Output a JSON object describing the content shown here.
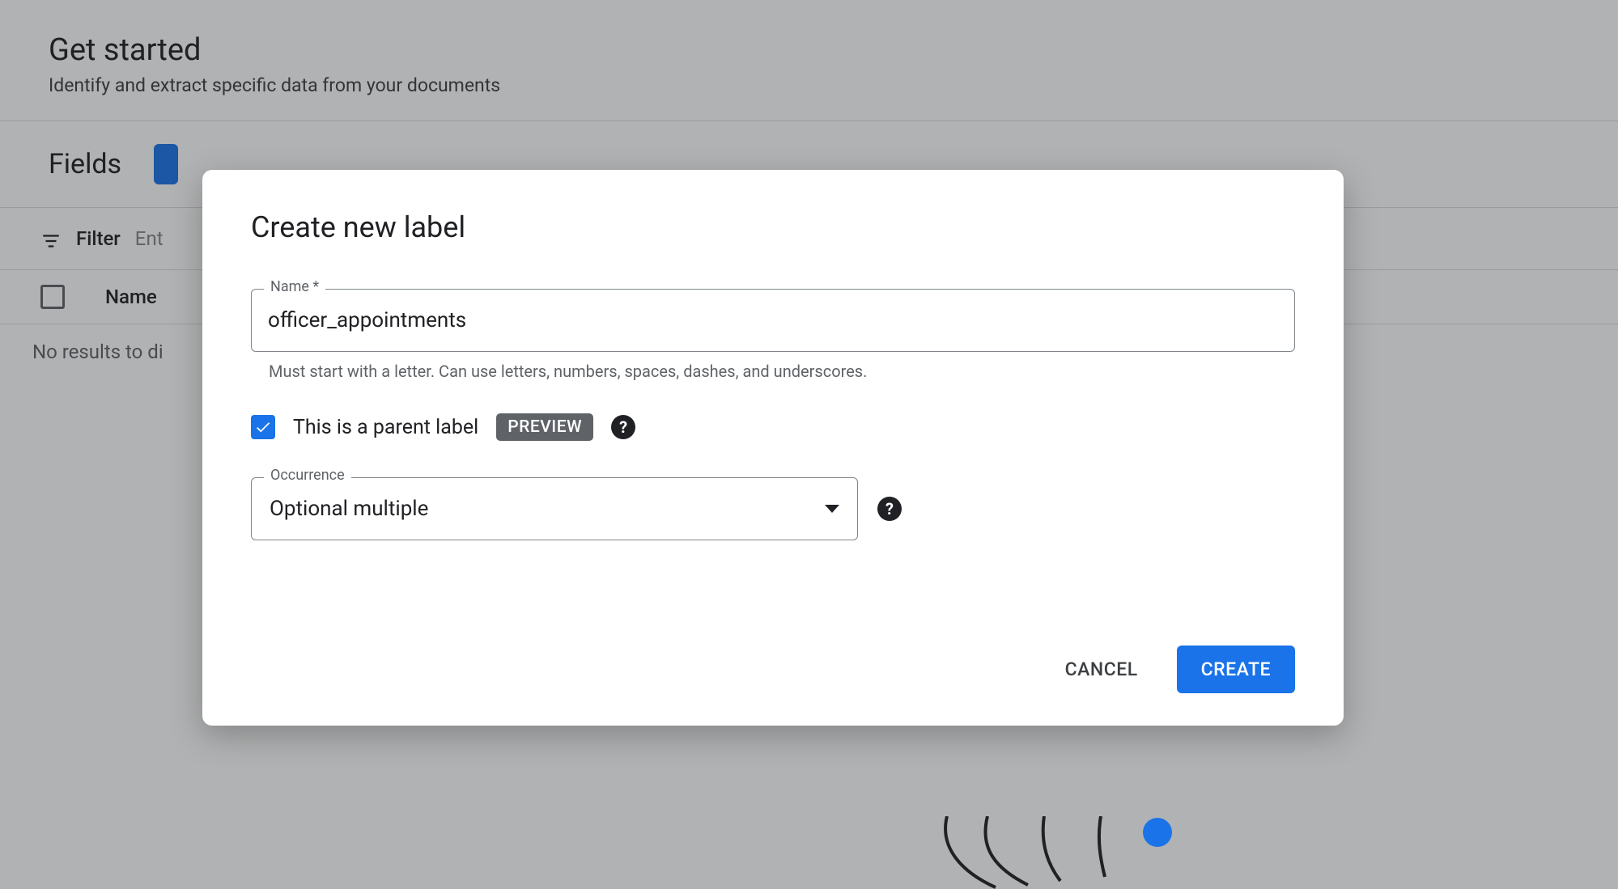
{
  "bg": {
    "title": "Get started",
    "subtitle": "Identify and extract specific data from your documents",
    "fields_heading": "Fields",
    "filter_label": "Filter",
    "filter_placeholder": "Ent",
    "col_name": "Name",
    "no_results": "No results to di"
  },
  "dialog": {
    "title": "Create new label",
    "name_field": {
      "label": "Name *",
      "value": "officer_appointments",
      "helper": "Must start with a letter. Can use letters, numbers, spaces, dashes, and underscores."
    },
    "parent_checkbox": {
      "checked": true,
      "label": "This is a parent label",
      "chip": "PREVIEW"
    },
    "occurrence": {
      "label": "Occurrence",
      "value": "Optional multiple"
    },
    "actions": {
      "cancel": "CANCEL",
      "create": "CREATE"
    }
  }
}
